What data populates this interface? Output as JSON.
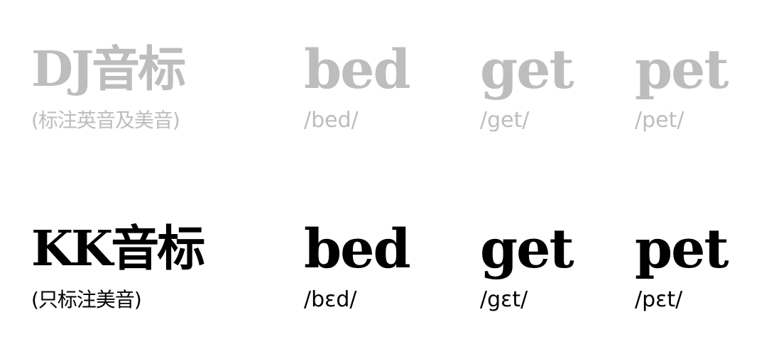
{
  "dj": {
    "title": "DJ音标",
    "note": "(标注英音及美音)",
    "words": [
      {
        "word": "bed",
        "phonetic": "/bed/"
      },
      {
        "word": "get",
        "phonetic": "/get/"
      },
      {
        "word": "pet",
        "phonetic": "/pet/"
      }
    ]
  },
  "kk": {
    "title": "KK音标",
    "note": "(只标注美音)",
    "words": [
      {
        "word": "bed",
        "phonetic": "/bɛd/"
      },
      {
        "word": "get",
        "phonetic": "/gɛt/"
      },
      {
        "word": "pet",
        "phonetic": "/pɛt/"
      }
    ]
  },
  "colors": {
    "dj_text": "#bdbdbd",
    "kk_text": "#000000"
  }
}
